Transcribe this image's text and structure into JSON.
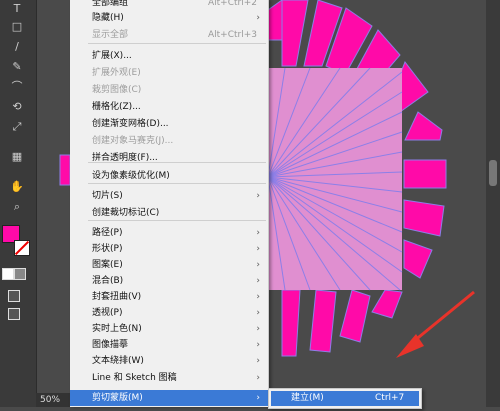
{
  "menu": {
    "items": [
      {
        "label": "全部编组",
        "shortcut": "Alt+Ctrl+2",
        "arrow": false,
        "disabled": false
      },
      {
        "label": "隐藏(H)",
        "shortcut": "",
        "arrow": true,
        "disabled": false
      },
      {
        "label": "显示全部",
        "shortcut": "Alt+Ctrl+3",
        "arrow": false,
        "disabled": true
      },
      {
        "label": "扩展(X)...",
        "shortcut": "",
        "arrow": false,
        "disabled": false
      },
      {
        "label": "扩展外观(E)",
        "shortcut": "",
        "arrow": false,
        "disabled": true
      },
      {
        "label": "栽剪图像(C)",
        "shortcut": "",
        "arrow": false,
        "disabled": true
      },
      {
        "label": "栅格化(Z)...",
        "shortcut": "",
        "arrow": false,
        "disabled": false
      },
      {
        "label": "创建渐变网格(D)...",
        "shortcut": "",
        "arrow": false,
        "disabled": false
      },
      {
        "label": "创建对象马赛克(J)...",
        "shortcut": "",
        "arrow": false,
        "disabled": true
      },
      {
        "label": "拼合透明度(F)...",
        "shortcut": "",
        "arrow": false,
        "disabled": false
      },
      {
        "label": "设为像素级优化(M)",
        "shortcut": "",
        "arrow": false,
        "disabled": false
      },
      {
        "label": "切片(S)",
        "shortcut": "",
        "arrow": true,
        "disabled": false
      },
      {
        "label": "创建裁切标记(C)",
        "shortcut": "",
        "arrow": false,
        "disabled": false
      },
      {
        "label": "路径(P)",
        "shortcut": "",
        "arrow": true,
        "disabled": false
      },
      {
        "label": "形状(P)",
        "shortcut": "",
        "arrow": true,
        "disabled": false
      },
      {
        "label": "图案(E)",
        "shortcut": "",
        "arrow": true,
        "disabled": false
      },
      {
        "label": "混合(B)",
        "shortcut": "",
        "arrow": true,
        "disabled": false
      },
      {
        "label": "封套扭曲(V)",
        "shortcut": "",
        "arrow": true,
        "disabled": false
      },
      {
        "label": "透视(P)",
        "shortcut": "",
        "arrow": true,
        "disabled": false
      },
      {
        "label": "实时上色(N)",
        "shortcut": "",
        "arrow": true,
        "disabled": false
      },
      {
        "label": "图像描摹",
        "shortcut": "",
        "arrow": true,
        "disabled": false
      },
      {
        "label": "文本绕排(W)",
        "shortcut": "",
        "arrow": true,
        "disabled": false
      },
      {
        "label": "Line 和 Sketch 图稿",
        "shortcut": "",
        "arrow": true,
        "disabled": false
      },
      {
        "label": "剪切蒙版(M)",
        "shortcut": "",
        "arrow": true,
        "disabled": false
      }
    ]
  },
  "submenu": {
    "label": "建立(M)",
    "shortcut": "Ctrl+7"
  },
  "status": {
    "zoom": "50%"
  },
  "tools": [
    "T",
    "□",
    "/",
    "✎",
    "⌒",
    "⟲",
    "⤢",
    "▦",
    "✋",
    "⌕"
  ],
  "colors": {
    "magenta": "#ff0aa8",
    "pink_square": "#e08fd0",
    "lines": "#8c7fe8",
    "arrow": "#e8332a",
    "highlight": "#3b7ad6"
  }
}
